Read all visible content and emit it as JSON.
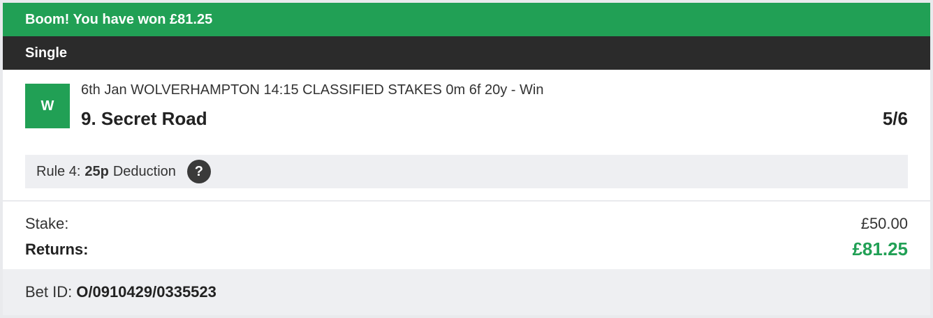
{
  "banner": {
    "text": "Boom! You have won £81.25",
    "color": "#21a055"
  },
  "bet_type": "Single",
  "selection": {
    "result_badge": "W",
    "event": "6th Jan WOLVERHAMPTON 14:15 CLASSIFIED STAKES 0m 6f 20y - Win",
    "runner": "9. Secret Road",
    "odds": "5/6",
    "rule4": {
      "prefix": "Rule 4:",
      "amount": "25p",
      "suffix": "Deduction",
      "help_icon": "question-icon",
      "help_glyph": "?"
    }
  },
  "totals": {
    "stake_label": "Stake:",
    "stake_value": "£50.00",
    "returns_label": "Returns:",
    "returns_value": "£81.25"
  },
  "footer": {
    "bet_id_label": "Bet ID:",
    "bet_id_value": "O/0910429/0335523"
  }
}
